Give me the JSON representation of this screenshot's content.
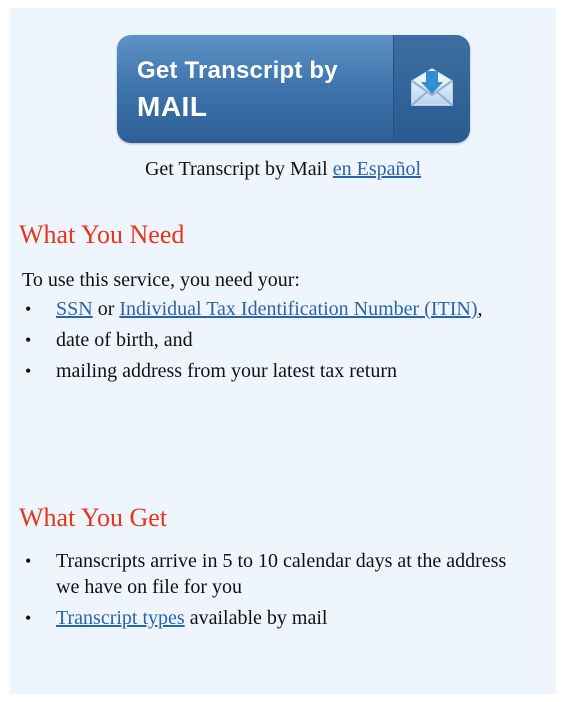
{
  "button": {
    "line1": "Get Transcript by",
    "line2": "MAIL",
    "icon": "download-envelope-icon"
  },
  "caption": {
    "text": "Get Transcript by Mail",
    "link": "en Español"
  },
  "need": {
    "heading": "What You Need",
    "intro": "To use this service, you need your:",
    "items": [
      {
        "link1": "SSN",
        "text_or": " or ",
        "link2": "Individual Tax Identification Number (ITIN)",
        "suffix": ","
      },
      {
        "text": "date of birth, and"
      },
      {
        "text": "mailing address from your latest tax return"
      }
    ]
  },
  "get": {
    "heading": "What You Get",
    "items": [
      {
        "text": "Transcripts arrive in 5 to 10 calendar days at the  address we have on file for you"
      },
      {
        "link": "Transcript types",
        "text": " available by mail"
      }
    ]
  },
  "colors": {
    "panel_bg": "#eef5fc",
    "heading": "#e8341b",
    "link": "#2a63ad",
    "button": "#3f76ad"
  }
}
